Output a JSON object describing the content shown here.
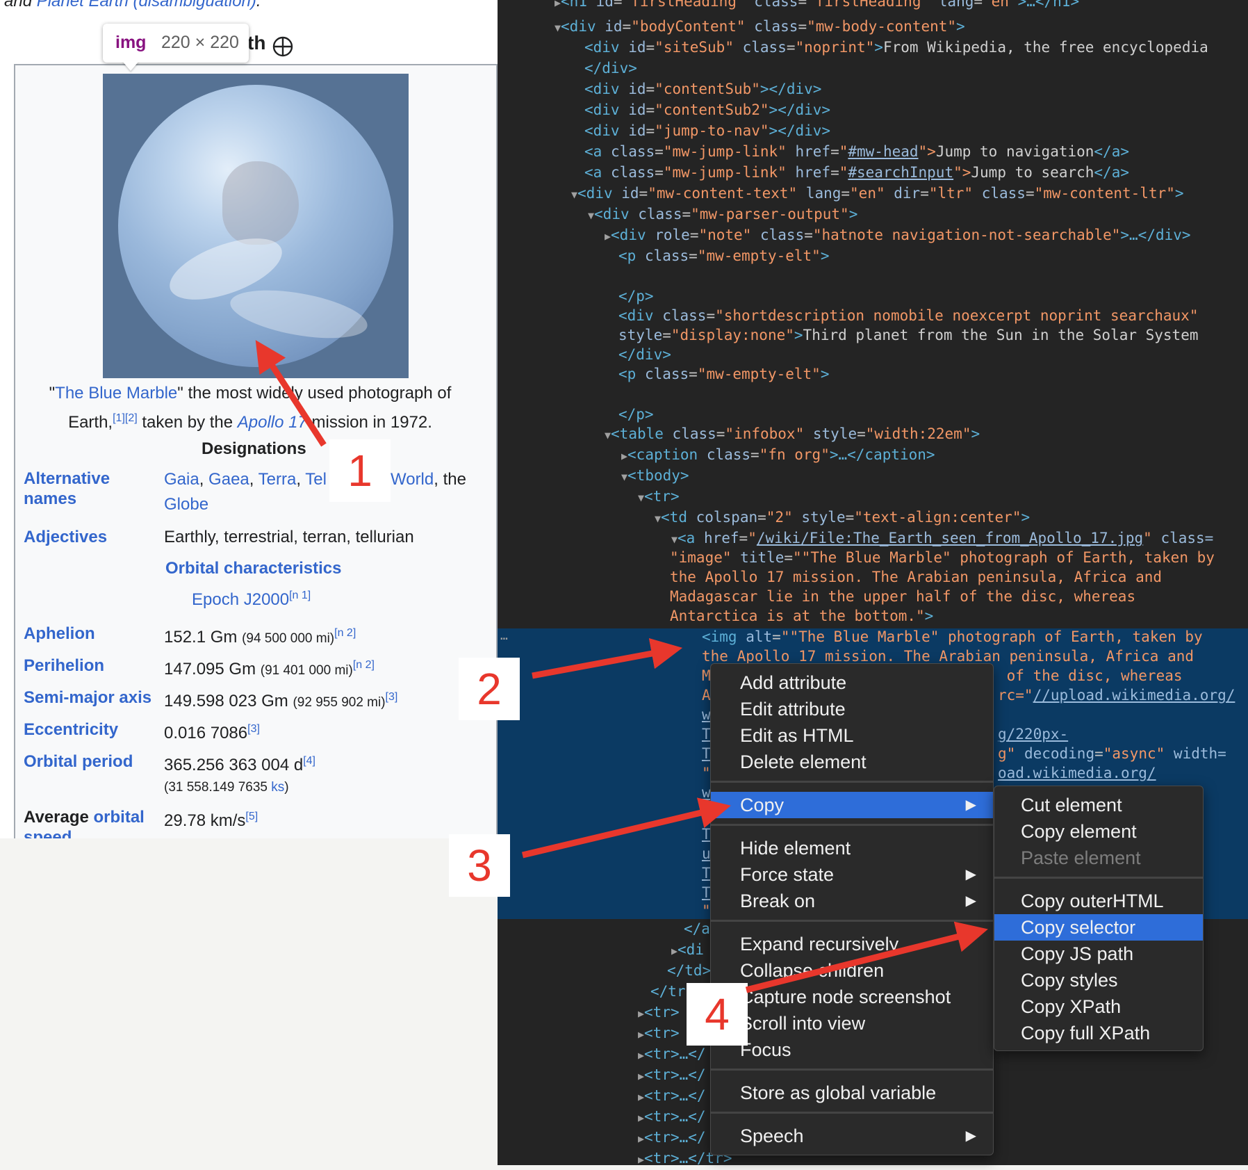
{
  "left_page": {
    "top_text_prefix": "and ",
    "top_text_link": "Planet Earth (disambiguation)",
    "top_text_suffix": ".",
    "heading_tail": "th",
    "tooltip": {
      "tag": "img",
      "dims": "220 × 220"
    },
    "caption": {
      "q1": "\"",
      "link1": "The Blue Marble",
      "t1": "\" the most widely used photograph of",
      "t2": "Earth,",
      "sup1": "[1][2]",
      "t3": " taken by the ",
      "link2": "Apollo 17",
      "t4": " mission in 1972."
    },
    "designations_heading": "Designations",
    "alt_names_label_1": "Alternative",
    "alt_names_label_2": "names",
    "alt_names": {
      "a": "Gaia",
      "sep1": ", ",
      "b": "Gaea",
      "sep2": ", ",
      "c": "Terra",
      "sep3": ", ",
      "d": "Tel",
      "e": "World",
      "sep5": ", the",
      "f": "Globe"
    },
    "adjectives_label": "Adjectives",
    "adjectives_value": "Earthly, terrestrial, terran, tellurian",
    "orbital_heading": "Orbital characteristics",
    "epoch_link": "Epoch J2000",
    "epoch_sup": "[n 1]",
    "rows": {
      "aphelion": {
        "label": "Aphelion",
        "value": "152.1 Gm ",
        "small": "(94 500 000 mi)",
        "sup": "[n 2]"
      },
      "perihelion": {
        "label": "Perihelion",
        "value": "147.095 Gm ",
        "small": "(91 401 000 mi)",
        "sup": "[n 2]"
      },
      "semimajor": {
        "label": "Semi-major axis",
        "value": "149.598 023 Gm ",
        "small": "(92 955 902 mi)",
        "sup": "[3]"
      },
      "ecc": {
        "label": "Eccentricity",
        "value": "0.016 7086",
        "sup": "[3]"
      },
      "period": {
        "label": "Orbital period",
        "value": "365.256 363 004 d",
        "sup": "[4]",
        "sub_pre": "(31 558.149 7635 ",
        "sub_link": "ks",
        "sub_post": ")"
      },
      "speed": {
        "label_plain": "Average ",
        "label_link": "orbital",
        "label_2": "speed",
        "value": "29.78 km/s",
        "sup": "[5]"
      }
    }
  },
  "callouts": [
    "1",
    "2",
    "3",
    "4"
  ],
  "devtools": {
    "lines": {
      "l1_tag": "<h1 ",
      "l1_a1": "id",
      "l1_v1": "\"firstHeading\"",
      "l1_a2": "class",
      "l1_v2": "\"firstHeading\"",
      "l1_a3": "lang",
      "l1_v3": "\"en\"",
      "l1_end": ">…</h1>",
      "l2_tag": "<div ",
      "l2_a1": "id",
      "l2_v1": "\"bodyContent\"",
      "l2_a2": "class",
      "l2_v2": "\"mw-body-content\"",
      "l2_end": ">",
      "l3_tag": "<div ",
      "l3_a1": "id",
      "l3_v1": "\"siteSub\"",
      "l3_a2": "class",
      "l3_v2": "\"noprint\"",
      "l3_gt": ">",
      "l3_text": "From Wikipedia, the free encyclopedia",
      "l4": "</div>",
      "l5_tag": "<div ",
      "l5_a1": "id",
      "l5_v1": "\"contentSub\"",
      "l5_end": "></div>",
      "l6_tag": "<div ",
      "l6_a1": "id",
      "l6_v1": "\"contentSub2\"",
      "l6_end": "></div>",
      "l7_tag": "<div ",
      "l7_a1": "id",
      "l7_v1": "\"jump-to-nav\"",
      "l7_end": "></div>",
      "l8_tag": "<a ",
      "l8_a1": "class",
      "l8_v1": "\"mw-jump-link\"",
      "l8_a2": "href",
      "l8_q": "\"",
      "l8_link": "#mw-head",
      "l8_gt": "\">",
      "l8_text": "Jump to navigation",
      "l8_end": "</a>",
      "l9_tag": "<a ",
      "l9_a1": "class",
      "l9_v1": "\"mw-jump-link\"",
      "l9_a2": "href",
      "l9_q": "\"",
      "l9_link": "#searchInput",
      "l9_gt": "\">",
      "l9_text": "Jump to search",
      "l9_end": "</a>",
      "l10_tag": "<div ",
      "l10_a1": "id",
      "l10_v1": "\"mw-content-text\"",
      "l10_a2": "lang",
      "l10_v2": "\"en\"",
      "l10_a3": "dir",
      "l10_v3": "\"ltr\"",
      "l10_a4": "class",
      "l10_v4": "\"mw-content-ltr\"",
      "l10_end": ">",
      "l11_tag": "<div ",
      "l11_a1": "class",
      "l11_v1": "\"mw-parser-output\"",
      "l11_end": ">",
      "l12_tag": "<div ",
      "l12_a1": "role",
      "l12_v1": "\"note\"",
      "l12_a2": "class",
      "l12_v2": "\"hatnote navigation-not-searchable\"",
      "l12_end": ">…</div>",
      "l13_tag": "<p ",
      "l13_a1": "class",
      "l13_v1": "\"mw-empty-elt\"",
      "l13_end": ">",
      "l14": "</p>",
      "l15_tag": "<div ",
      "l15_a1": "class",
      "l15_v1": "\"shortdescription nomobile noexcerpt noprint searchaux\"",
      "l16_a1": "style",
      "l16_v1": "\"display:none\"",
      "l16_gt": ">",
      "l16_text": "Third planet from the Sun in the Solar System",
      "l17": "</div>",
      "l18_tag": "<p ",
      "l18_a1": "class",
      "l18_v1": "\"mw-empty-elt\"",
      "l18_end": ">",
      "l19": "</p>",
      "l20_tag": "<table ",
      "l20_a1": "class",
      "l20_v1": "\"infobox\"",
      "l20_a2": "style",
      "l20_v2": "\"width:22em\"",
      "l20_end": ">",
      "l21_tag": "<caption ",
      "l21_a1": "class",
      "l21_v1": "\"fn org\"",
      "l21_end": ">…</caption>",
      "l22": "<tbody>",
      "l23": "<tr>",
      "l24_tag": "<td ",
      "l24_a1": "colspan",
      "l24_v1": "\"2\"",
      "l24_a2": "style",
      "l24_v2": "\"text-align:center\"",
      "l24_end": ">",
      "l25_tag": "<a ",
      "l25_a1": "href",
      "l25_q": "\"",
      "l25_link": "/wiki/File:The_Earth_seen_from_Apollo_17.jpg",
      "l25_q2": "\" ",
      "l25_a2": "class=",
      "l26_v": "\"image\" ",
      "l26_a": "title",
      "l26_v2": "\"\"The Blue Marble\" photograph of Earth, taken by",
      "l27": "the Apollo 17 mission. The Arabian peninsula, Africa and",
      "l28": "Madagascar lie in the upper half of the disc, whereas",
      "l29": "Antarctica is at the bottom.\"",
      "l29_gt": ">",
      "l30_tag": "<img ",
      "l30_a": "alt",
      "l30_v": "\"\"The Blue Marble\" photograph of Earth, taken by",
      "l31": "the Apollo 17 mission. The Arabian peninsula, Africa and",
      "l32_a": "M",
      "l32_b": " of the disc, whereas",
      "l33_a": "A",
      "l33_b": "rc=\"",
      "l33_link": "//upload.wikimedia.org/",
      "l34_a": "w",
      "l35_a": "T",
      "l35_b": "g/220px-",
      "l36_a": "T",
      "l36_b": "g\" ",
      "l36_attr": "decoding",
      "l36_v": "\"async\"",
      "l36_attr2": "width=",
      "l37_a": "\"",
      "l37_link": "oad.wikimedia.org/",
      "l38_a": "w",
      "l39_a": "T",
      "l40_a": "u",
      "l41_a": "T",
      "l42_a": "T",
      "l43_a": "\"",
      "l44": "</a",
      "l45": "<di",
      "l46": "</td>",
      "l47": "</tr",
      "l48": "<tr>",
      "l49": "<tr>",
      "l50": "<tr>…</",
      "l51": "<tr>…</",
      "l52": "<tr>…</",
      "l53": "<tr>…</",
      "l54": "<tr>…</",
      "l55": "<tr>…</tr>"
    },
    "dots": "…"
  },
  "context_menu": {
    "items": [
      "Add attribute",
      "Edit attribute",
      "Edit as HTML",
      "Delete element",
      "Copy",
      "Hide element",
      "Force state",
      "Break on",
      "Expand recursively",
      "Collapse children",
      "Capture node screenshot",
      "Scroll into view",
      "Focus",
      "Store as global variable",
      "Speech"
    ],
    "submenu_arrow": "▶"
  },
  "copy_submenu": {
    "items": [
      "Cut element",
      "Copy element",
      "Paste element",
      "Copy outerHTML",
      "Copy selector",
      "Copy JS path",
      "Copy styles",
      "Copy XPath",
      "Copy full XPath"
    ]
  },
  "colors": {
    "link": "#3366cc",
    "callout": "#e8372c",
    "highlight": "#2e6dd9",
    "devtools_bg": "#242424",
    "selected_band": "#0b3a63"
  }
}
